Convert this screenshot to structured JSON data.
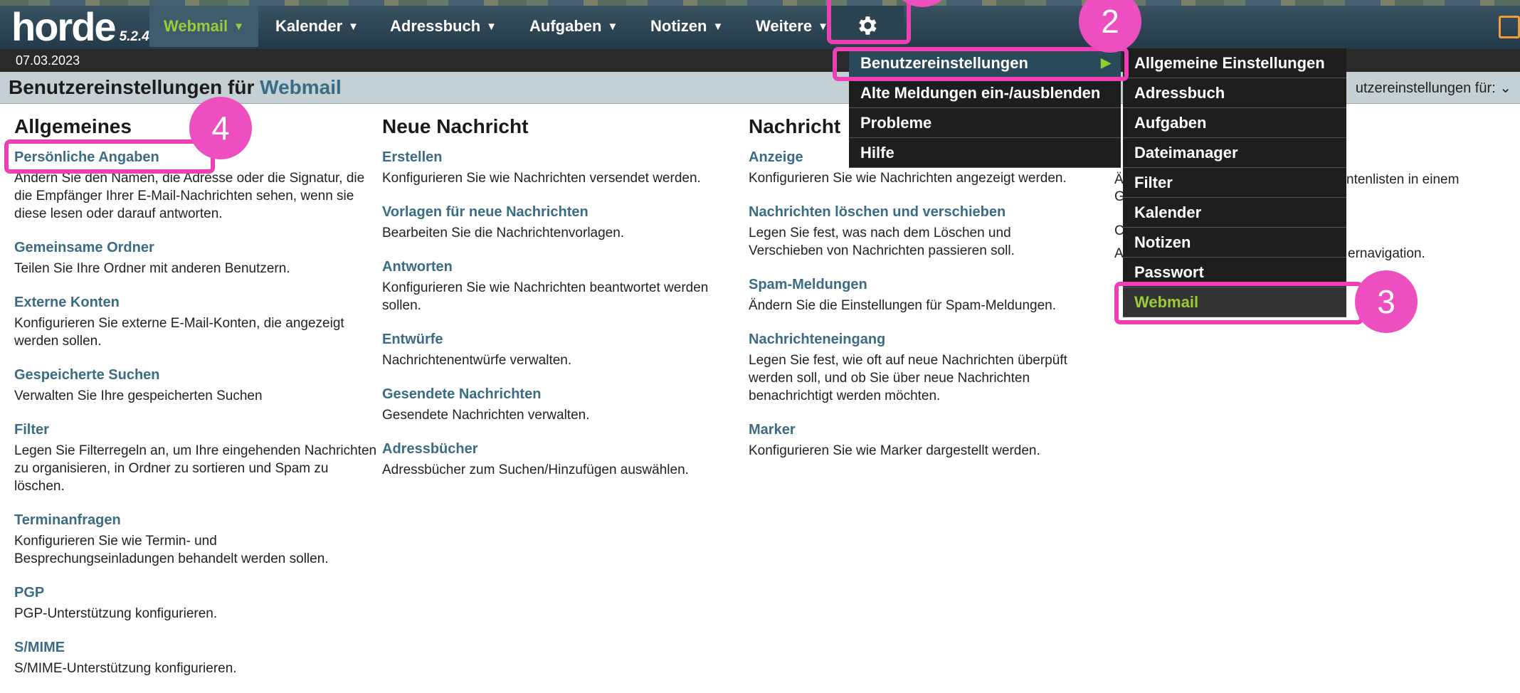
{
  "app": {
    "logo": "horde",
    "version": "5.2.4"
  },
  "nav": {
    "webmail": "Webmail",
    "kalender": "Kalender",
    "adressbuch": "Adressbuch",
    "aufgaben": "Aufgaben",
    "notizen": "Notizen",
    "weitere": "Weitere"
  },
  "date": "07.03.2023",
  "page": {
    "title_prefix": "Benutzereinstellungen für",
    "title_app": "Webmail",
    "right_select": "utzereinstellungen für:"
  },
  "col1": {
    "heading": "Allgemeines",
    "items": [
      {
        "h": "Persönliche Angaben",
        "d": "Ändern Sie den Namen, die Adresse oder die Signatur, die die Empfänger Ihrer E-Mail-Nachrichten sehen, wenn sie diese lesen oder darauf antworten."
      },
      {
        "h": "Gemeinsame Ordner",
        "d": "Teilen Sie Ihre Ordner mit anderen Benutzern."
      },
      {
        "h": "Externe Konten",
        "d": "Konfigurieren Sie externe E-Mail-Konten, die angezeigt werden sollen."
      },
      {
        "h": "Gespeicherte Suchen",
        "d": "Verwalten Sie Ihre gespeicherten Suchen"
      },
      {
        "h": "Filter",
        "d": "Legen Sie Filterregeln an, um Ihre eingehenden Nachrichten zu organisieren, in Ordner zu sortieren und Spam zu löschen."
      },
      {
        "h": "Terminanfragen",
        "d": "Konfigurieren Sie wie Termin- und Besprechungseinladungen behandelt werden sollen."
      },
      {
        "h": "PGP",
        "d": "PGP-Unterstützung konfigurieren."
      },
      {
        "h": "S/MIME",
        "d": "S/MIME-Unterstützung konfigurieren."
      }
    ]
  },
  "col2": {
    "heading": "Neue Nachricht",
    "items": [
      {
        "h": "Erstellen",
        "d": "Konfigurieren Sie wie Nachrichten versendet werden."
      },
      {
        "h": "Vorlagen für neue Nachrichten",
        "d": "Bearbeiten Sie die Nachrichtenvorlagen."
      },
      {
        "h": "Antworten",
        "d": "Konfigurieren Sie wie Nachrichten beantwortet werden sollen."
      },
      {
        "h": "Entwürfe",
        "d": "Nachrichtenentwürfe verwalten."
      },
      {
        "h": "Gesendete Nachrichten",
        "d": "Gesendete Nachrichten verwalten."
      },
      {
        "h": "Adressbücher",
        "d": "Adressbücher zum Suchen/Hinzufügen auswählen."
      }
    ]
  },
  "col3": {
    "heading": "Nachricht",
    "items": [
      {
        "h": "Anzeige",
        "d": "Konfigurieren Sie wie Nachrichten angezeigt werden."
      },
      {
        "h": "Nachrichten löschen und verschieben",
        "d": "Legen Sie fest, was nach dem Löschen und Verschieben von Nachrichten passieren soll."
      },
      {
        "h": "Spam-Meldungen",
        "d": "Ändern Sie die Einstellungen für Spam-Meldungen."
      },
      {
        "h": "Nachrichteneingang",
        "d": "Legen Sie fest, wie oft auf neue Nachrichten überpüft werden soll, und ob Sie über neue Nachrichten benachrichtigt werden möchten."
      },
      {
        "h": "Marker",
        "d": "Konfigurieren Sie wie Marker dargestellt werden."
      }
    ]
  },
  "col4_fragments": [
    "Ä",
    "ntenlisten in einem",
    "G",
    "C",
    "A",
    "ernavigation."
  ],
  "gear_menu": {
    "items": [
      "Benutzereinstellungen",
      "Alte Meldungen ein-/ausblenden",
      "Probleme",
      "Hilfe"
    ]
  },
  "submenu": {
    "items": [
      "Allgemeine Einstellungen",
      "Adressbuch",
      "Aufgaben",
      "Dateimanager",
      "Filter",
      "Kalender",
      "Notizen",
      "Passwort",
      "Webmail"
    ]
  },
  "badges": {
    "b2": "2",
    "b3": "3",
    "b4": "4"
  }
}
